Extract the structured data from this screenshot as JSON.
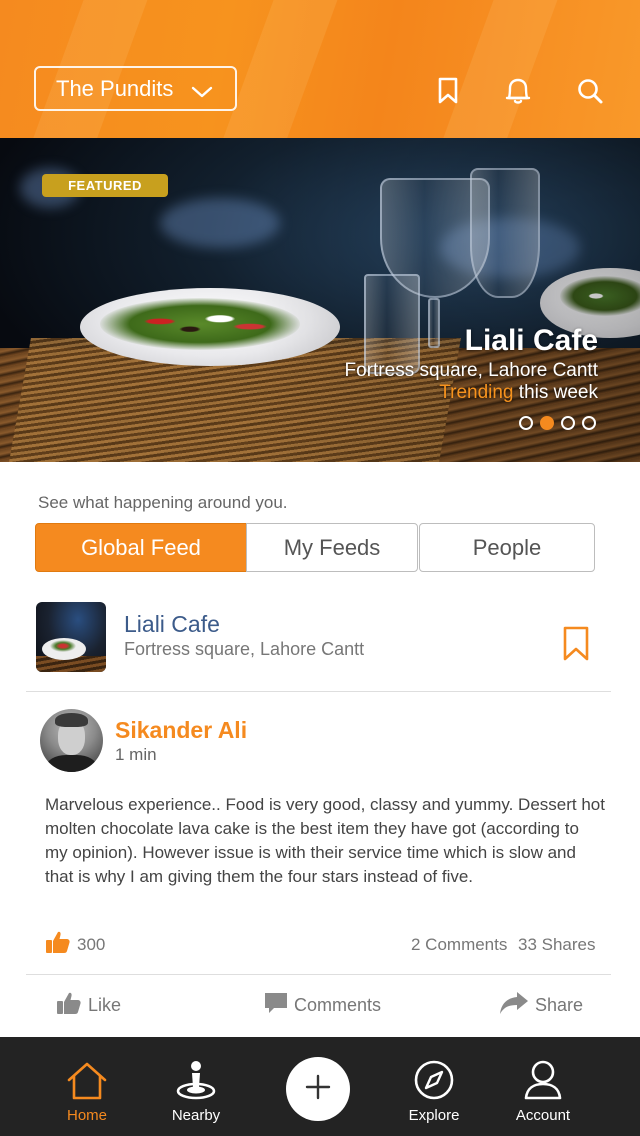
{
  "header": {
    "group_name": "The Pundits",
    "icons": [
      "bookmark-icon",
      "bell-icon",
      "search-icon"
    ]
  },
  "hero": {
    "badge": "FEATURED",
    "title": "Liali Cafe",
    "address": "Fortress square, Lahore Cantt",
    "trend_highlight": "Trending",
    "trend_rest": " this week",
    "slides_total": 4,
    "slide_active": 2
  },
  "feed": {
    "tagline": "See what happening around you.",
    "tabs": [
      {
        "label": "Global Feed",
        "active": true
      },
      {
        "label": "My Feeds",
        "active": false
      },
      {
        "label": "People",
        "active": false
      }
    ]
  },
  "place": {
    "name": "Liali Cafe",
    "address": "Fortress square, Lahore Cantt"
  },
  "post": {
    "author": "Sikander Ali",
    "time": "1 min",
    "body": "Marvelous experience.. Food is very good, classy and yummy. Dessert hot molten chocolate lava cake is the best item they have got (according to my opinion). However issue is with their service time which is slow and that is why I am giving them the four stars instead of five.",
    "likes": "300",
    "comments": "2 Comments",
    "shares": "33  Shares"
  },
  "actions": {
    "like": "Like",
    "comments": "Comments",
    "share": "Share"
  },
  "nav": {
    "home": "Home",
    "nearby": "Nearby",
    "explore": "Explore",
    "account": "Account"
  },
  "colors": {
    "accent": "#f58a1f",
    "link_blue": "#3c5b8a",
    "nav_bg": "#232323",
    "badge": "#c8a01e"
  }
}
